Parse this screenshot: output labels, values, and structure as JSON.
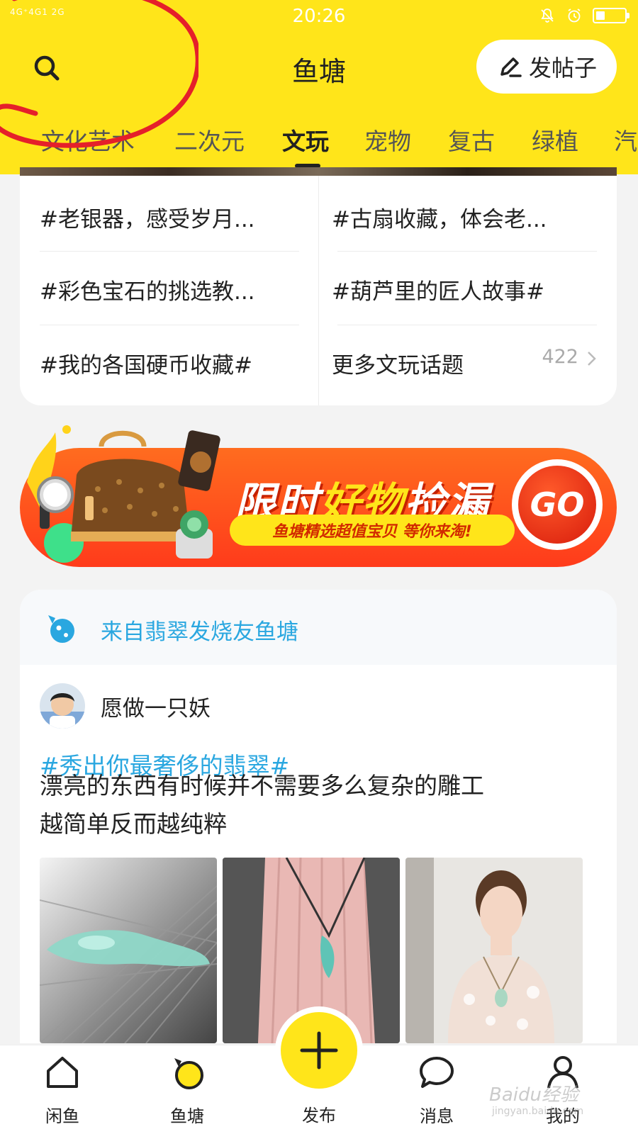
{
  "status_bar": {
    "signal": "4G⁺4G1 2G",
    "time": "20:26"
  },
  "header": {
    "title": "鱼塘",
    "post_button_label": "发帖子"
  },
  "tabs": [
    {
      "label": "文化艺术",
      "active": false
    },
    {
      "label": "二次元",
      "active": false
    },
    {
      "label": "文玩",
      "active": true
    },
    {
      "label": "宠物",
      "active": false
    },
    {
      "label": "复古",
      "active": false
    },
    {
      "label": "绿植",
      "active": false
    },
    {
      "label": "汽",
      "active": false
    }
  ],
  "topics": [
    "#老银器，感受岁月...",
    "#古扇收藏，体会老...",
    "#彩色宝石的挑选教...",
    "#葫芦里的匠人故事#",
    "#我的各国硬币收藏#"
  ],
  "more_topics": {
    "label": "更多文玩话题",
    "count": "422"
  },
  "promo": {
    "title_part1": "限时",
    "title_highlight": "好物",
    "title_part2": "捡漏",
    "subtitle": "鱼塘精选超值宝贝 等你来淘!",
    "go_label": "GO"
  },
  "feed": {
    "source": "来自翡翠发烧友鱼塘",
    "username": "愿做一只妖",
    "topic": "#秀出你最奢侈的翡翠#",
    "text_line1": "漂亮的东西有时候并不需要多么复杂的雕工",
    "text_line2": "越简单反而越纯粹"
  },
  "bottom_nav": {
    "items": [
      {
        "label": "闲鱼",
        "icon": "home-icon"
      },
      {
        "label": "鱼塘",
        "icon": "pond-icon"
      },
      {
        "label": "发布",
        "icon": "plus-icon"
      },
      {
        "label": "消息",
        "icon": "message-icon"
      },
      {
        "label": "我的",
        "icon": "person-icon"
      }
    ]
  },
  "watermark": {
    "text": "Baidu经验",
    "sub": "jingyan.baidu.com"
  },
  "colors": {
    "brand_yellow": "#ffe51a",
    "link_blue": "#2aa7e0",
    "promo_orange": "#ff4d1c"
  }
}
